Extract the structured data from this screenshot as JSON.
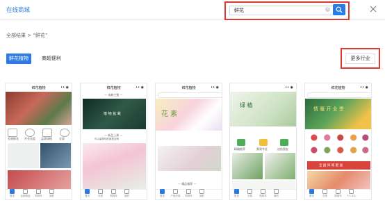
{
  "header": {
    "title": "在线商城",
    "search_value": "鲜花"
  },
  "breadcrumb": {
    "text": "全部结果 > “鲜花”"
  },
  "tabs": [
    {
      "label": "鲜花植物"
    },
    {
      "label": "商超便利"
    }
  ],
  "more_button": {
    "label": "更多行业"
  },
  "cards": [
    {
      "title": "鲜花植物",
      "nav": [
        "首页",
        "全部商品",
        "购物车",
        "我的",
        ""
      ],
      "labels": [
        "礼物鲜花",
        "开业花篮",
        "盆栽绿植",
        "全部"
      ]
    },
    {
      "title": "鲜花植物",
      "nav": [
        "首页",
        "分类",
        "购物车",
        "我的",
        ""
      ],
      "labels": [
        "— 本期主推 —",
        "植 物 盆 栽",
        "— 新品上架 —",
        "可以装饰你的家居空间"
      ]
    },
    {
      "title": "鲜花植物",
      "nav": [
        "首页",
        "产品分类",
        "购物车",
        "我的",
        ""
      ],
      "labels": [
        "花 素",
        "— 精品推荐 —"
      ]
    },
    {
      "title": "",
      "nav": [
        "首页",
        "分类",
        "购物车",
        "我的",
        ""
      ],
      "labels": [
        "绿 植",
        "精编推荐",
        "景观专区",
        "送给朋友"
      ]
    },
    {
      "title": "鲜花植物",
      "nav": [
        "首页",
        "分类",
        "购物车",
        "个人中心",
        ""
      ],
      "labels": [
        "情 暖 开 业 季",
        "全 国 同 城 配 送"
      ]
    }
  ]
}
